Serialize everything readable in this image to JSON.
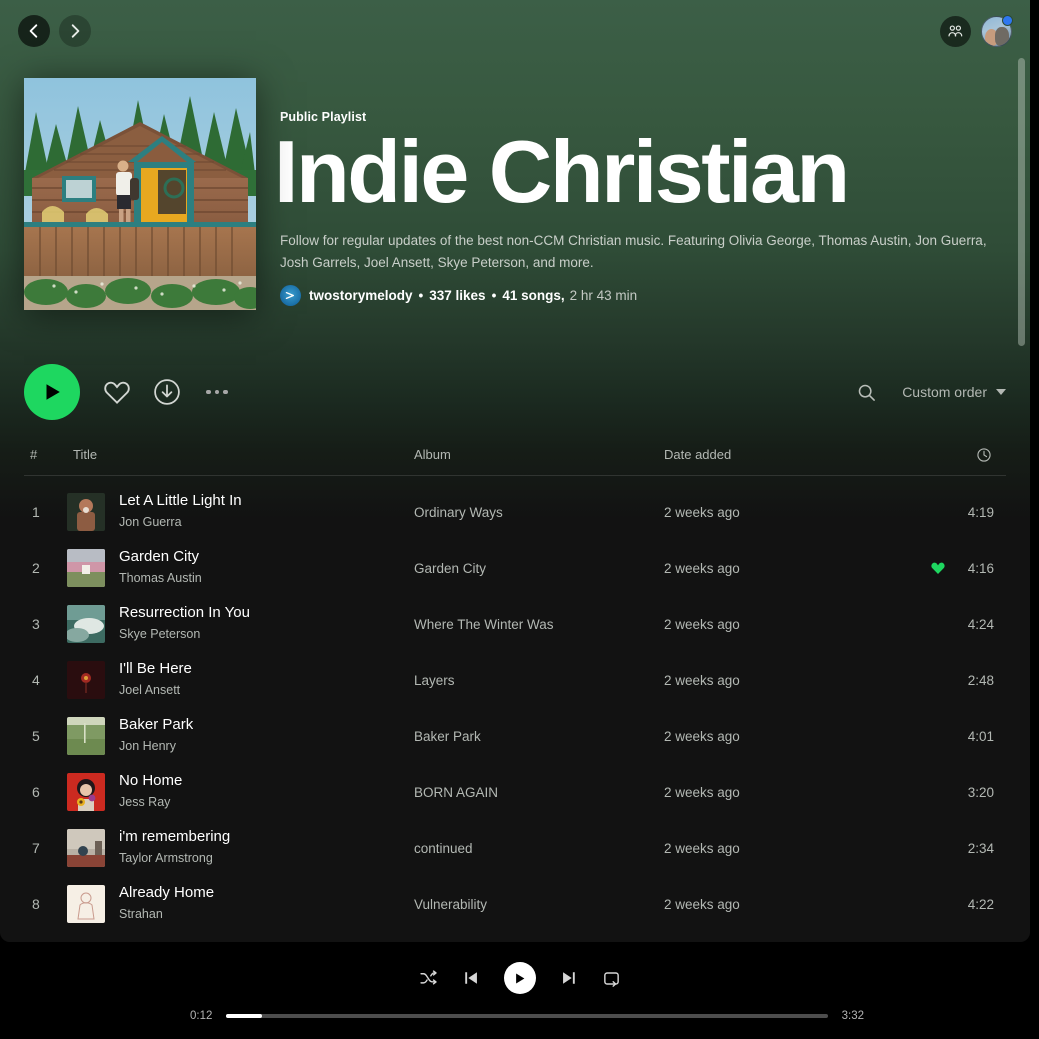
{
  "window": {
    "app": "Spotify",
    "bg_top": "#3c5f47",
    "bg_bottom": "#121212",
    "accent_green": "#1ed760"
  },
  "topbar": {
    "back_icon": "chevron-left-icon",
    "forward_icon": "chevron-right-icon",
    "friends_icon": "friends-activity-icon",
    "avatar_name": "user-avatar",
    "badge_color": "#2e77f0"
  },
  "playlist": {
    "type_label": "Public Playlist",
    "title": "Indie Christian",
    "description": "Follow for regular updates of the best non-CCM Christian music. Featuring Olivia George, Thomas Austin, Jon Guerra, Josh Garrels, Joel Ansett, Skye Peterson, and more.",
    "owner": "twostorymelody",
    "likes": "337 likes",
    "songs": "41 songs,",
    "duration": "2 hr 43 min",
    "separator": "•",
    "cover_alt": "log-cabin-photo-cover"
  },
  "toolbar": {
    "play_icon": "play-icon",
    "like_icon": "heart-outline-icon",
    "download_icon": "download-circle-icon",
    "more_icon": "more-options-icon",
    "search_icon": "search-icon",
    "sort_label": "Custom order",
    "sort_caret_icon": "chevron-down-icon"
  },
  "table": {
    "headers": {
      "number": "#",
      "title": "Title",
      "album": "Album",
      "date_added": "Date added",
      "duration_icon": "clock-icon"
    },
    "rows": [
      {
        "number": "1",
        "title": "Let A Little Light In",
        "artist": "Jon Guerra",
        "album": "Ordinary Ways",
        "date_added": "2 weeks ago",
        "duration": "4:19",
        "liked": false,
        "art": "portrait-dark-green"
      },
      {
        "number": "2",
        "title": "Garden City",
        "artist": "Thomas Austin",
        "album": "Garden City",
        "date_added": "2 weeks ago",
        "duration": "4:16",
        "liked": true,
        "art": "landscape-field-pink"
      },
      {
        "number": "3",
        "title": "Resurrection In You",
        "artist": "Skye Peterson",
        "album": "Where The Winter Was",
        "date_added": "2 weeks ago",
        "duration": "4:24",
        "liked": false,
        "art": "coastal-painting-teal"
      },
      {
        "number": "4",
        "title": "I'll Be Here",
        "artist": "Joel Ansett",
        "album": "Layers",
        "date_added": "2 weeks ago",
        "duration": "2:48",
        "liked": false,
        "art": "dark-maroon-flower"
      },
      {
        "number": "5",
        "title": "Baker Park",
        "artist": "Jon Henry",
        "album": "Baker Park",
        "date_added": "2 weeks ago",
        "duration": "4:01",
        "liked": false,
        "art": "green-park-photo"
      },
      {
        "number": "6",
        "title": "No Home",
        "artist": "Jess Ray",
        "album": "BORN AGAIN",
        "date_added": "2 weeks ago",
        "duration": "3:20",
        "liked": false,
        "art": "red-portrait-sunflower"
      },
      {
        "number": "7",
        "title": "i'm remembering",
        "artist": "Taylor Armstrong",
        "album": "continued",
        "date_added": "2 weeks ago",
        "duration": "2:34",
        "liked": false,
        "art": "room-interior-photo"
      },
      {
        "number": "8",
        "title": "Already Home",
        "artist": "Strahan",
        "album": "Vulnerability",
        "date_added": "2 weeks ago",
        "duration": "4:22",
        "liked": false,
        "art": "cream-line-drawing"
      }
    ]
  },
  "player": {
    "shuffle_icon": "shuffle-icon",
    "previous_icon": "previous-track-icon",
    "play_icon": "play-icon",
    "next_icon": "next-track-icon",
    "repeat_icon": "repeat-icon",
    "elapsed": "0:12",
    "total": "3:32",
    "progress_percent": 6
  }
}
